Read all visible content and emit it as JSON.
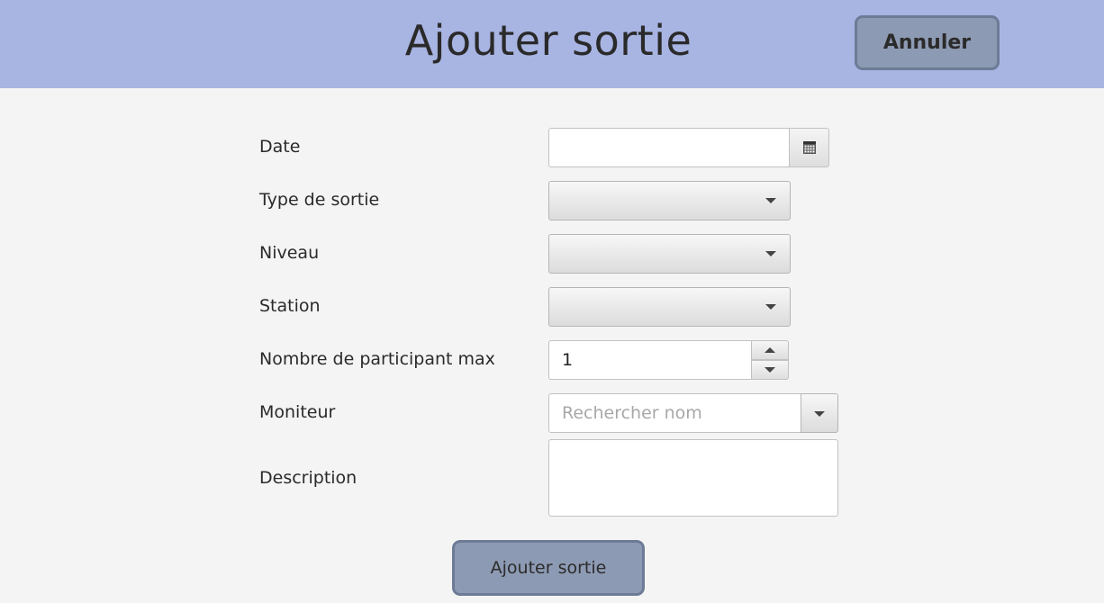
{
  "header": {
    "title": "Ajouter sortie",
    "cancel_label": "Annuler",
    "background_color": "#a8b4e2"
  },
  "form": {
    "date": {
      "label": "Date",
      "value": "",
      "icon": "calendar-icon"
    },
    "type_sortie": {
      "label": "Type de sortie",
      "value": ""
    },
    "niveau": {
      "label": "Niveau",
      "value": ""
    },
    "station": {
      "label": "Station",
      "value": ""
    },
    "participants": {
      "label": "Nombre de participant max",
      "value": "1"
    },
    "moniteur": {
      "label": "Moniteur",
      "placeholder": "Rechercher nom",
      "value": ""
    },
    "description": {
      "label": "Description",
      "value": ""
    }
  },
  "actions": {
    "submit_label": "Ajouter sortie",
    "button_color": "#8d9ab3"
  }
}
